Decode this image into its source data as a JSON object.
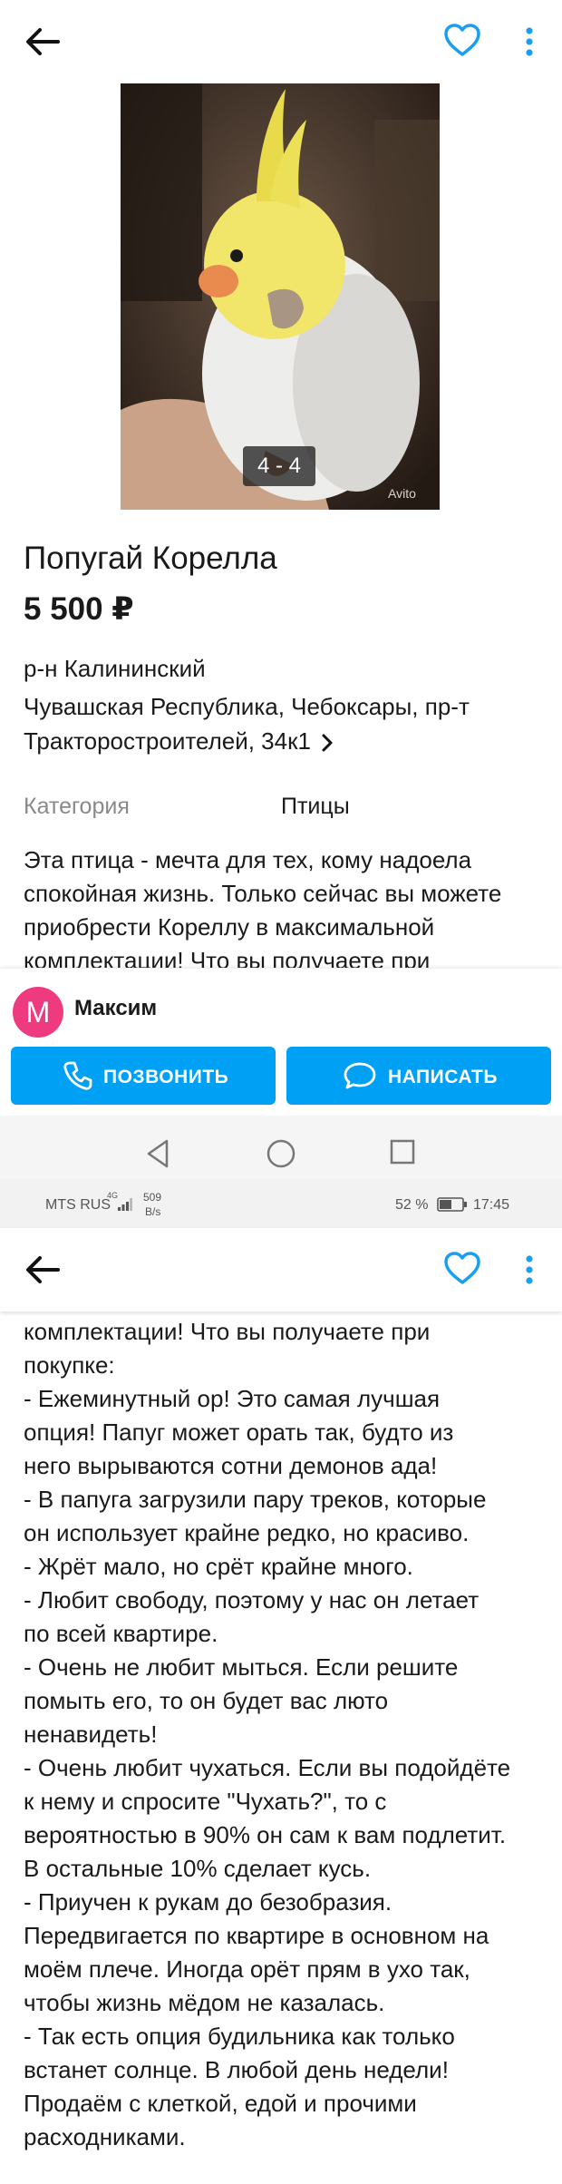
{
  "listing": {
    "photo_counter": "4 - 4",
    "photo_watermark": "Avito",
    "title": "Попугай Корелла",
    "price": "5 500 ₽",
    "district": "р-н Калининский",
    "address_line1": "Чувашская Республика, Чебоксары, пр-т",
    "address_line2": "Тракторостроителей, 34к1",
    "category_label": "Категория",
    "category_value": "Птицы",
    "description_preview": [
      "Эта птица - мечта для тех, кому надоела",
      "спокойная жизнь. Только сейчас вы можете",
      "приобрести Кореллу в максимальной",
      "комплектации! Что вы получаете при"
    ],
    "description_continued": [
      "комплектации! Что вы получаете при",
      "покупке:",
      "- Ежеминутный ор! Это самая лучшая",
      "опция! Папуг может орать так, будто из",
      "него вырываются сотни демонов ада!",
      "- В папуга загрузили пару треков, которые",
      "он использует крайне редко, но красиво.",
      "- Жрёт мало, но срёт крайне много.",
      "- Любит свободу, поэтому у нас он летает",
      "по всей квартире.",
      "- Очень не любит мыться. Если решите",
      "помыть его, то он будет вас люто",
      "ненавидеть!",
      "- Очень любит чухаться. Если вы подойдёте",
      "к нему и спросите \"Чухать?\", то с",
      "вероятностью в 90% он сам к вам подлетит.",
      "В остальные 10% сделает кусь.",
      "- Приучен к рукам до безобразия.",
      "Передвигается по квартире в основном на",
      "моём плече. Иногда орёт прям в ухо так,",
      "чтобы жизнь мёдом не казалась.",
      "- Так есть опция будильника как только",
      "встанет солнце. В любой день недели!",
      "Продаём с клеткой, едой и прочими",
      "расходниками."
    ]
  },
  "seller": {
    "avatar_letter": "M",
    "name": "Максим"
  },
  "actions": {
    "call_label": "ПОЗВОНИТЬ",
    "write_label": "НАПИСАТЬ"
  },
  "status_bar": {
    "carrier": "MTS RUS",
    "network": "4G",
    "speed_value": "509",
    "speed_unit": "B/s",
    "battery": "52 %",
    "time": "17:45"
  },
  "icons": {
    "back": "arrow-left-icon",
    "favorite": "heart-icon",
    "more": "more-vertical-icon",
    "call": "phone-icon",
    "write": "chat-icon"
  },
  "colors": {
    "accent": "#00a0f4",
    "heart": "#1a9ef0",
    "avatar": "#ee3b7f"
  }
}
